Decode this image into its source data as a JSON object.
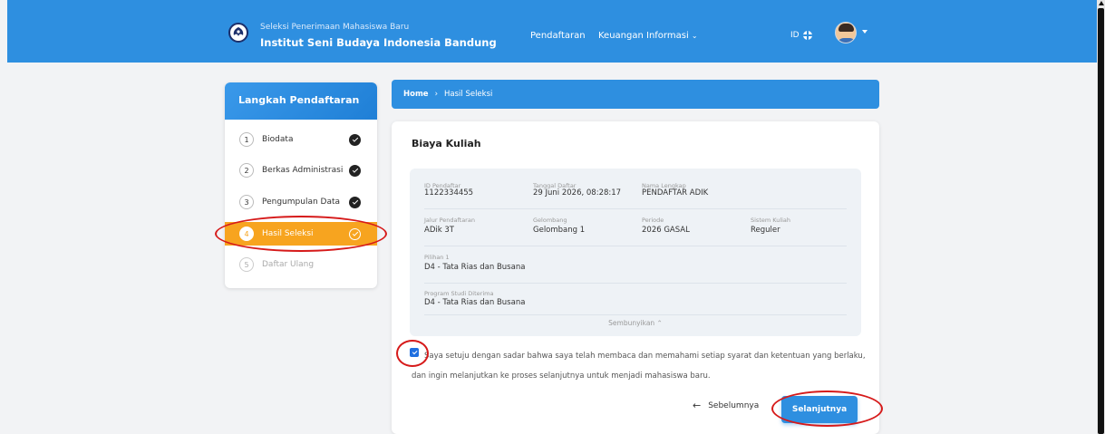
{
  "header": {
    "subtitle": "Seleksi Penerimaan Mahasiswa Baru",
    "title": "Institut Seni Budaya Indonesia Bandung",
    "nav": [
      "Pendaftaran",
      "Keuangan",
      "Informasi"
    ],
    "lang": "ID",
    "brand_color": "#2e8fe0",
    "icons": [
      "logo-emblem-icon",
      "chevron-down-icon",
      "globe-icon",
      "avatar",
      "caret-down-icon"
    ]
  },
  "sidebar": {
    "title": "Langkah Pendaftaran",
    "steps": [
      {
        "num": "1",
        "label": "Biodata",
        "status": "done"
      },
      {
        "num": "2",
        "label": "Berkas Administrasi",
        "status": "done"
      },
      {
        "num": "3",
        "label": "Pengumpulan Data",
        "status": "done"
      },
      {
        "num": "4",
        "label": "Hasil Seleksi",
        "status": "active"
      },
      {
        "num": "5",
        "label": "Daftar Ulang",
        "status": "pending"
      }
    ],
    "active_color": "#f7a41f"
  },
  "breadcrumb": {
    "home": "Home",
    "separator": "›",
    "current": "Hasil Seleksi"
  },
  "card": {
    "title": "Biaya Kuliah",
    "fields": {
      "id_label": "ID Pendaftar",
      "id_value": "1122334455",
      "date_label": "Tanggal Daftar",
      "date_value": "29 Juni 2026, 08:28:17",
      "name_label": "Nama Lengkap",
      "name_value": "PENDAFTAR ADIK",
      "jalur_label": "Jalur Pendaftaran",
      "jalur_value": "ADik 3T",
      "gelombang_label": "Gelombang",
      "gelombang_value": "Gelombang 1",
      "periode_label": "Periode",
      "periode_value": "2026 GASAL",
      "sistem_label": "Sistem Kuliah",
      "sistem_value": "Reguler",
      "pilihan_label": "Pilihan 1",
      "pilihan_value": "D4 - Tata Rias dan Busana",
      "prodi_label": "Program Studi Diterima",
      "prodi_value": "D4 - Tata Rias dan Busana"
    },
    "hide_label": "Sembunyikan ⌃",
    "agreement": {
      "checked": true,
      "text": "Saya setuju dengan sadar bahwa saya telah membaca dan memahami setiap syarat dan ketentuan yang berlaku, dan ingin melanjutkan ke proses selanjutnya untuk menjadi mahasiswa baru."
    },
    "prev_label": "Sebelumnya",
    "next_label": "Selanjutnya"
  },
  "annotation_color": "#d61a1a"
}
